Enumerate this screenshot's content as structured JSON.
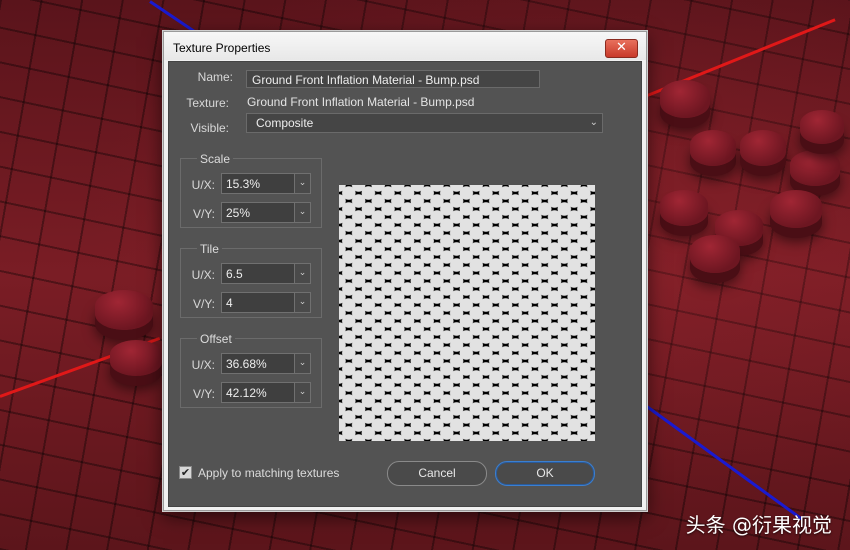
{
  "dialog": {
    "title": "Texture Properties",
    "close_glyph": "✕",
    "name_label": "Name:",
    "name_value": "Ground Front Inflation Material - Bump.psd",
    "texture_label": "Texture:",
    "texture_value": "Ground Front Inflation Material - Bump.psd",
    "visible_label": "Visible:",
    "visible_value": "Composite",
    "scale": {
      "title": "Scale",
      "ux_label": "U/X:",
      "ux_value": "15.3%",
      "vy_label": "V/Y:",
      "vy_value": "25%"
    },
    "tile": {
      "title": "Tile",
      "ux_label": "U/X:",
      "ux_value": "6.5",
      "vy_label": "V/Y:",
      "vy_value": "4"
    },
    "offset": {
      "title": "Offset",
      "ux_label": "U/X:",
      "ux_value": "36.68%",
      "vy_label": "V/Y:",
      "vy_value": "42.12%"
    },
    "apply_label": "Apply to matching textures",
    "apply_checked": true,
    "cancel_label": "Cancel",
    "ok_label": "OK"
  },
  "icons": {
    "chevron": "⌄",
    "check": "✔"
  },
  "colors": {
    "viewport_red": "#7a1d25",
    "dialog_body": "#535353",
    "ok_accent": "#3b7fd0"
  },
  "watermark": "头条 @衍果视觉"
}
